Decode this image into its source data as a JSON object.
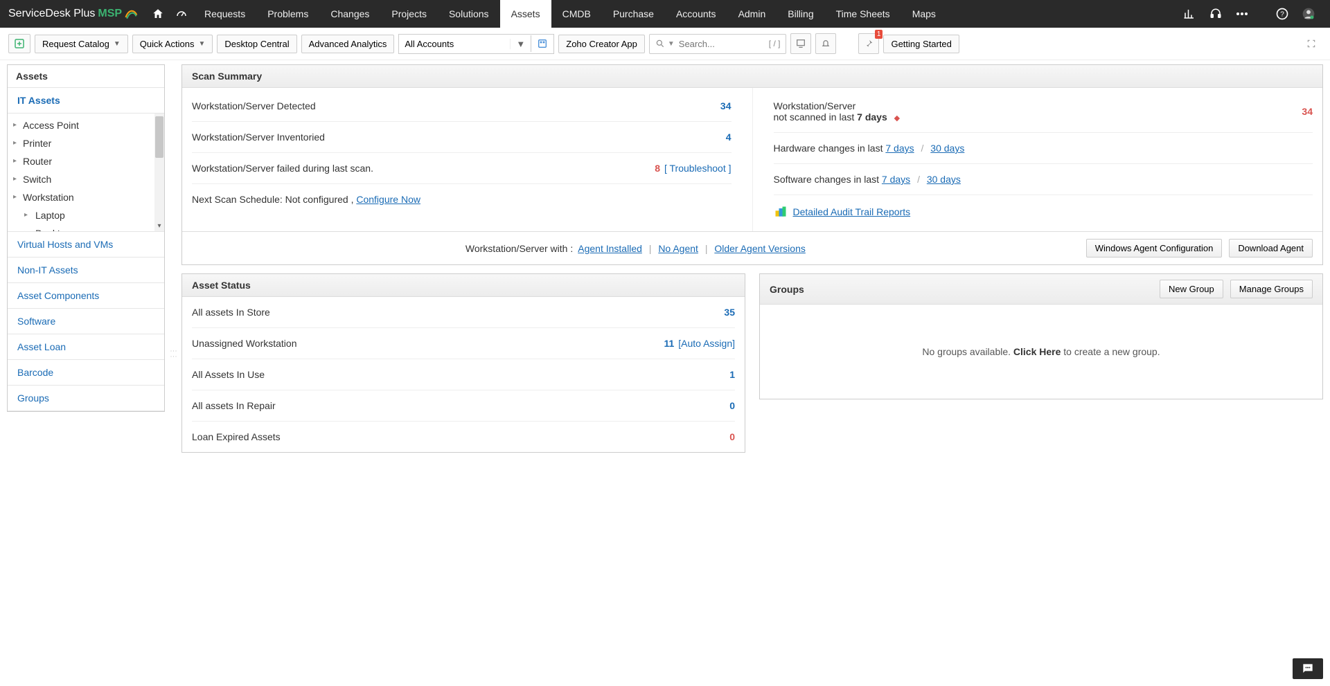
{
  "brand": {
    "name": "ServiceDesk Plus",
    "suffix": "MSP"
  },
  "topnav": {
    "items": [
      "Requests",
      "Problems",
      "Changes",
      "Projects",
      "Solutions",
      "Assets",
      "CMDB",
      "Purchase",
      "Accounts",
      "Admin",
      "Billing",
      "Time Sheets",
      "Maps"
    ],
    "active": "Assets"
  },
  "toolbar": {
    "request_catalog": "Request Catalog",
    "quick_actions": "Quick Actions",
    "desktop_central": "Desktop Central",
    "advanced_analytics": "Advanced Analytics",
    "accounts_value": "All Accounts",
    "zoho_creator": "Zoho Creator App",
    "search_placeholder": "Search...",
    "search_scope": "[ / ]",
    "getting_started": "Getting Started",
    "notif_badge": "1"
  },
  "sidebar": {
    "title": "Assets",
    "sections": [
      "IT Assets"
    ],
    "tree": [
      "Access Point",
      "Printer",
      "Router",
      "Switch",
      "Workstation"
    ],
    "tree_sub": [
      "Laptop",
      "Desktop"
    ],
    "links": [
      "Virtual Hosts and VMs",
      "Non-IT Assets",
      "Asset Components",
      "Software",
      "Asset Loan",
      "Barcode",
      "Groups"
    ]
  },
  "scan_summary": {
    "title": "Scan Summary",
    "rows_left": [
      {
        "label": "Workstation/Server Detected",
        "val": "34"
      },
      {
        "label": "Workstation/Server Inventoried",
        "val": "4"
      },
      {
        "label": "Workstation/Server failed during last scan.",
        "val": "8",
        "extra": "[ Troubleshoot ]",
        "red": true
      }
    ],
    "next_scan_prefix": "Next Scan Schedule: Not configured ,",
    "configure_now": "Configure Now",
    "not_scanned_label_a": "Workstation/Server",
    "not_scanned_label_b": "not scanned in last",
    "not_scanned_days": "7 days",
    "not_scanned_val": "34",
    "hw_changes": "Hardware changes in last",
    "sw_changes": "Software changes in last",
    "seven": "7 days",
    "thirty": "30 days",
    "audit": "Detailed Audit Trail Reports",
    "footer_prefix": "Workstation/Server with :",
    "footer_links": [
      "Agent Installed",
      "No Agent",
      "Older Agent Versions"
    ],
    "btn_win": "Windows Agent Configuration",
    "btn_dl": "Download Agent"
  },
  "asset_status": {
    "title": "Asset Status",
    "rows": [
      {
        "label": "All assets In Store",
        "val": "35"
      },
      {
        "label": "Unassigned Workstation",
        "val": "11",
        "extra": "[Auto Assign]"
      },
      {
        "label": "All Assets In Use",
        "val": "1"
      },
      {
        "label": "All assets In Repair",
        "val": "0"
      },
      {
        "label": "Loan Expired Assets",
        "val": "0",
        "red": true
      }
    ]
  },
  "groups": {
    "title": "Groups",
    "btn_new": "New Group",
    "btn_manage": "Manage Groups",
    "empty_pre": "No groups available.",
    "empty_link": "Click Here",
    "empty_post": "to create a new group."
  }
}
